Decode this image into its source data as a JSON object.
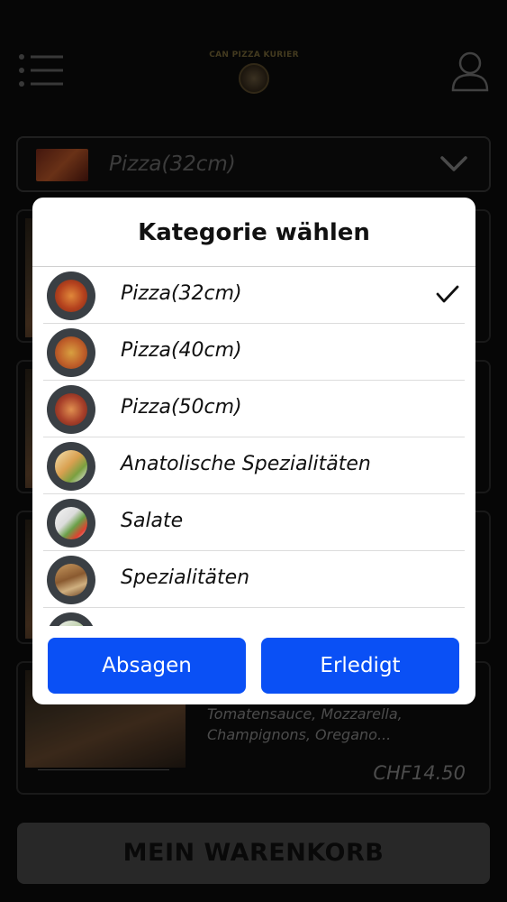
{
  "header": {
    "logo_text": "CAN PIZZA KURIER"
  },
  "category_select": {
    "selected_label": "Pizza(32cm)"
  },
  "cards": [
    {
      "description_line1": "Tomatensauce, Mozzarella,",
      "description_line2": "Champignons, Oregano...",
      "price": "CHF14.50"
    }
  ],
  "cart": {
    "label": "MEIN WARENKORB"
  },
  "dialog": {
    "title": "Kategorie wählen",
    "items": [
      {
        "label": "Pizza(32cm)",
        "selected": true,
        "icon": "pizza-32-icon"
      },
      {
        "label": "Pizza(40cm)",
        "selected": false,
        "icon": "pizza-40-icon"
      },
      {
        "label": "Pizza(50cm)",
        "selected": false,
        "icon": "pizza-50-icon"
      },
      {
        "label": "Anatolische Spezialitäten",
        "selected": false,
        "icon": "anatolian-icon"
      },
      {
        "label": "Salate",
        "selected": false,
        "icon": "salad-icon"
      },
      {
        "label": "Spezialitäten",
        "selected": false,
        "icon": "specialties-icon"
      }
    ],
    "cancel_label": "Absagen",
    "done_label": "Erledigt"
  },
  "colors": {
    "primary_button": "#0a50f5",
    "background": "#0b0b0b"
  }
}
